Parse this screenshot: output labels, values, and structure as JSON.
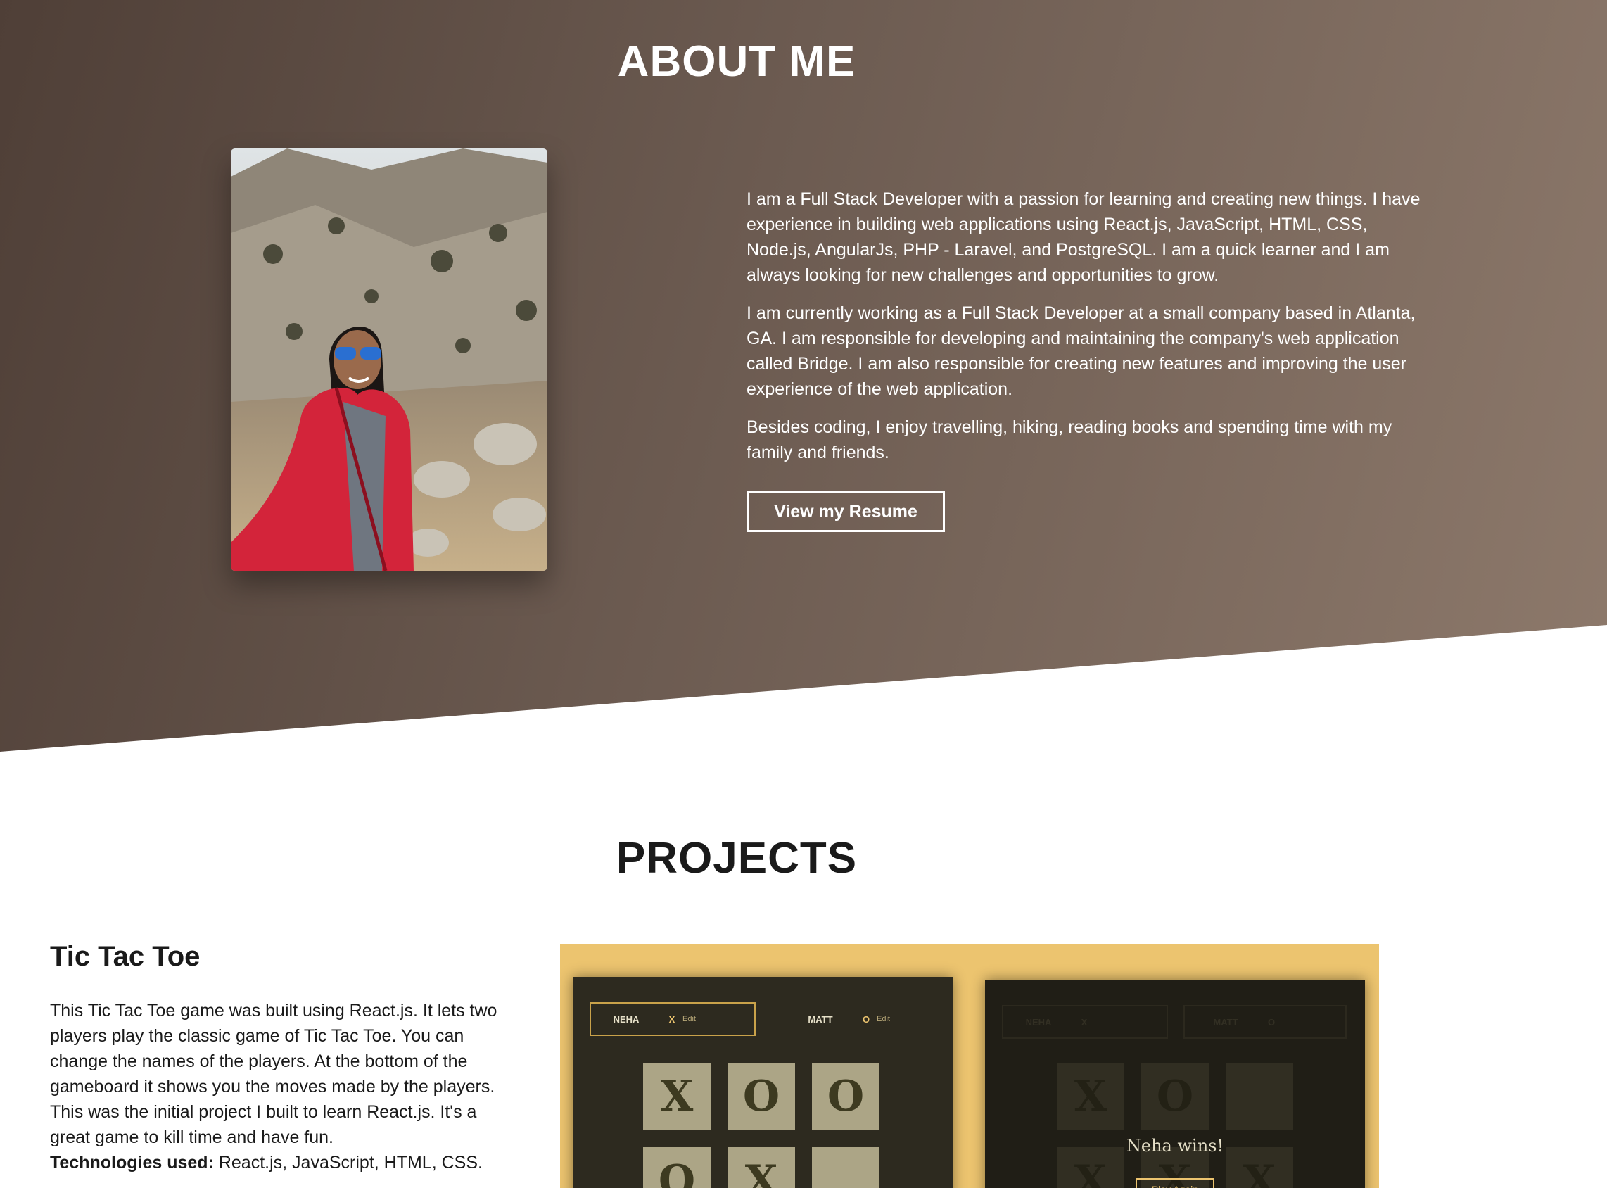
{
  "about": {
    "title": "ABOUT ME",
    "paragraphs": [
      "I am a Full Stack Developer with a passion for learning and creating new things. I have experience in building web applications using React.js, JavaScript, HTML, CSS, Node.js, AngularJs, PHP - Laravel, and PostgreSQL. I am a quick learner and I am always looking for new challenges and opportunities to grow.",
      "I am currently working as a Full Stack Developer at a small company based in Atlanta, GA. I am responsible for developing and maintaining the company's web application called Bridge. I am also responsible for creating new features and improving the user experience of the web application.",
      "Besides coding, I enjoy travelling, hiking, reading books and spending time with my family and friends."
    ],
    "resume_button": "View my Resume"
  },
  "projects": {
    "title": "PROJECTS",
    "items": [
      {
        "name": "Tic Tac Toe",
        "description": "This Tic Tac Toe game was built using React.js. It lets two players play the classic game of Tic Tac Toe. You can change the names of the players. At the bottom of the gameboard it shows you the moves made by the players. This was the initial project I built to learn React.js. It's a great game to kill time and have fun.",
        "tech_label": "Technologies used:",
        "tech_value": " React.js, JavaScript, HTML, CSS."
      }
    ]
  },
  "game_preview": {
    "player1": {
      "name": "NEHA",
      "symbol": "X",
      "edit": "Edit"
    },
    "player2": {
      "name": "MATT",
      "symbol": "O",
      "edit": "Edit"
    },
    "board_left": [
      "X",
      "O",
      "O",
      "O",
      "X",
      ""
    ],
    "board_right": [
      "X",
      "O",
      "",
      "X",
      "X",
      "X"
    ],
    "win_text": "Neha wins!",
    "play_again": "Play Again"
  }
}
